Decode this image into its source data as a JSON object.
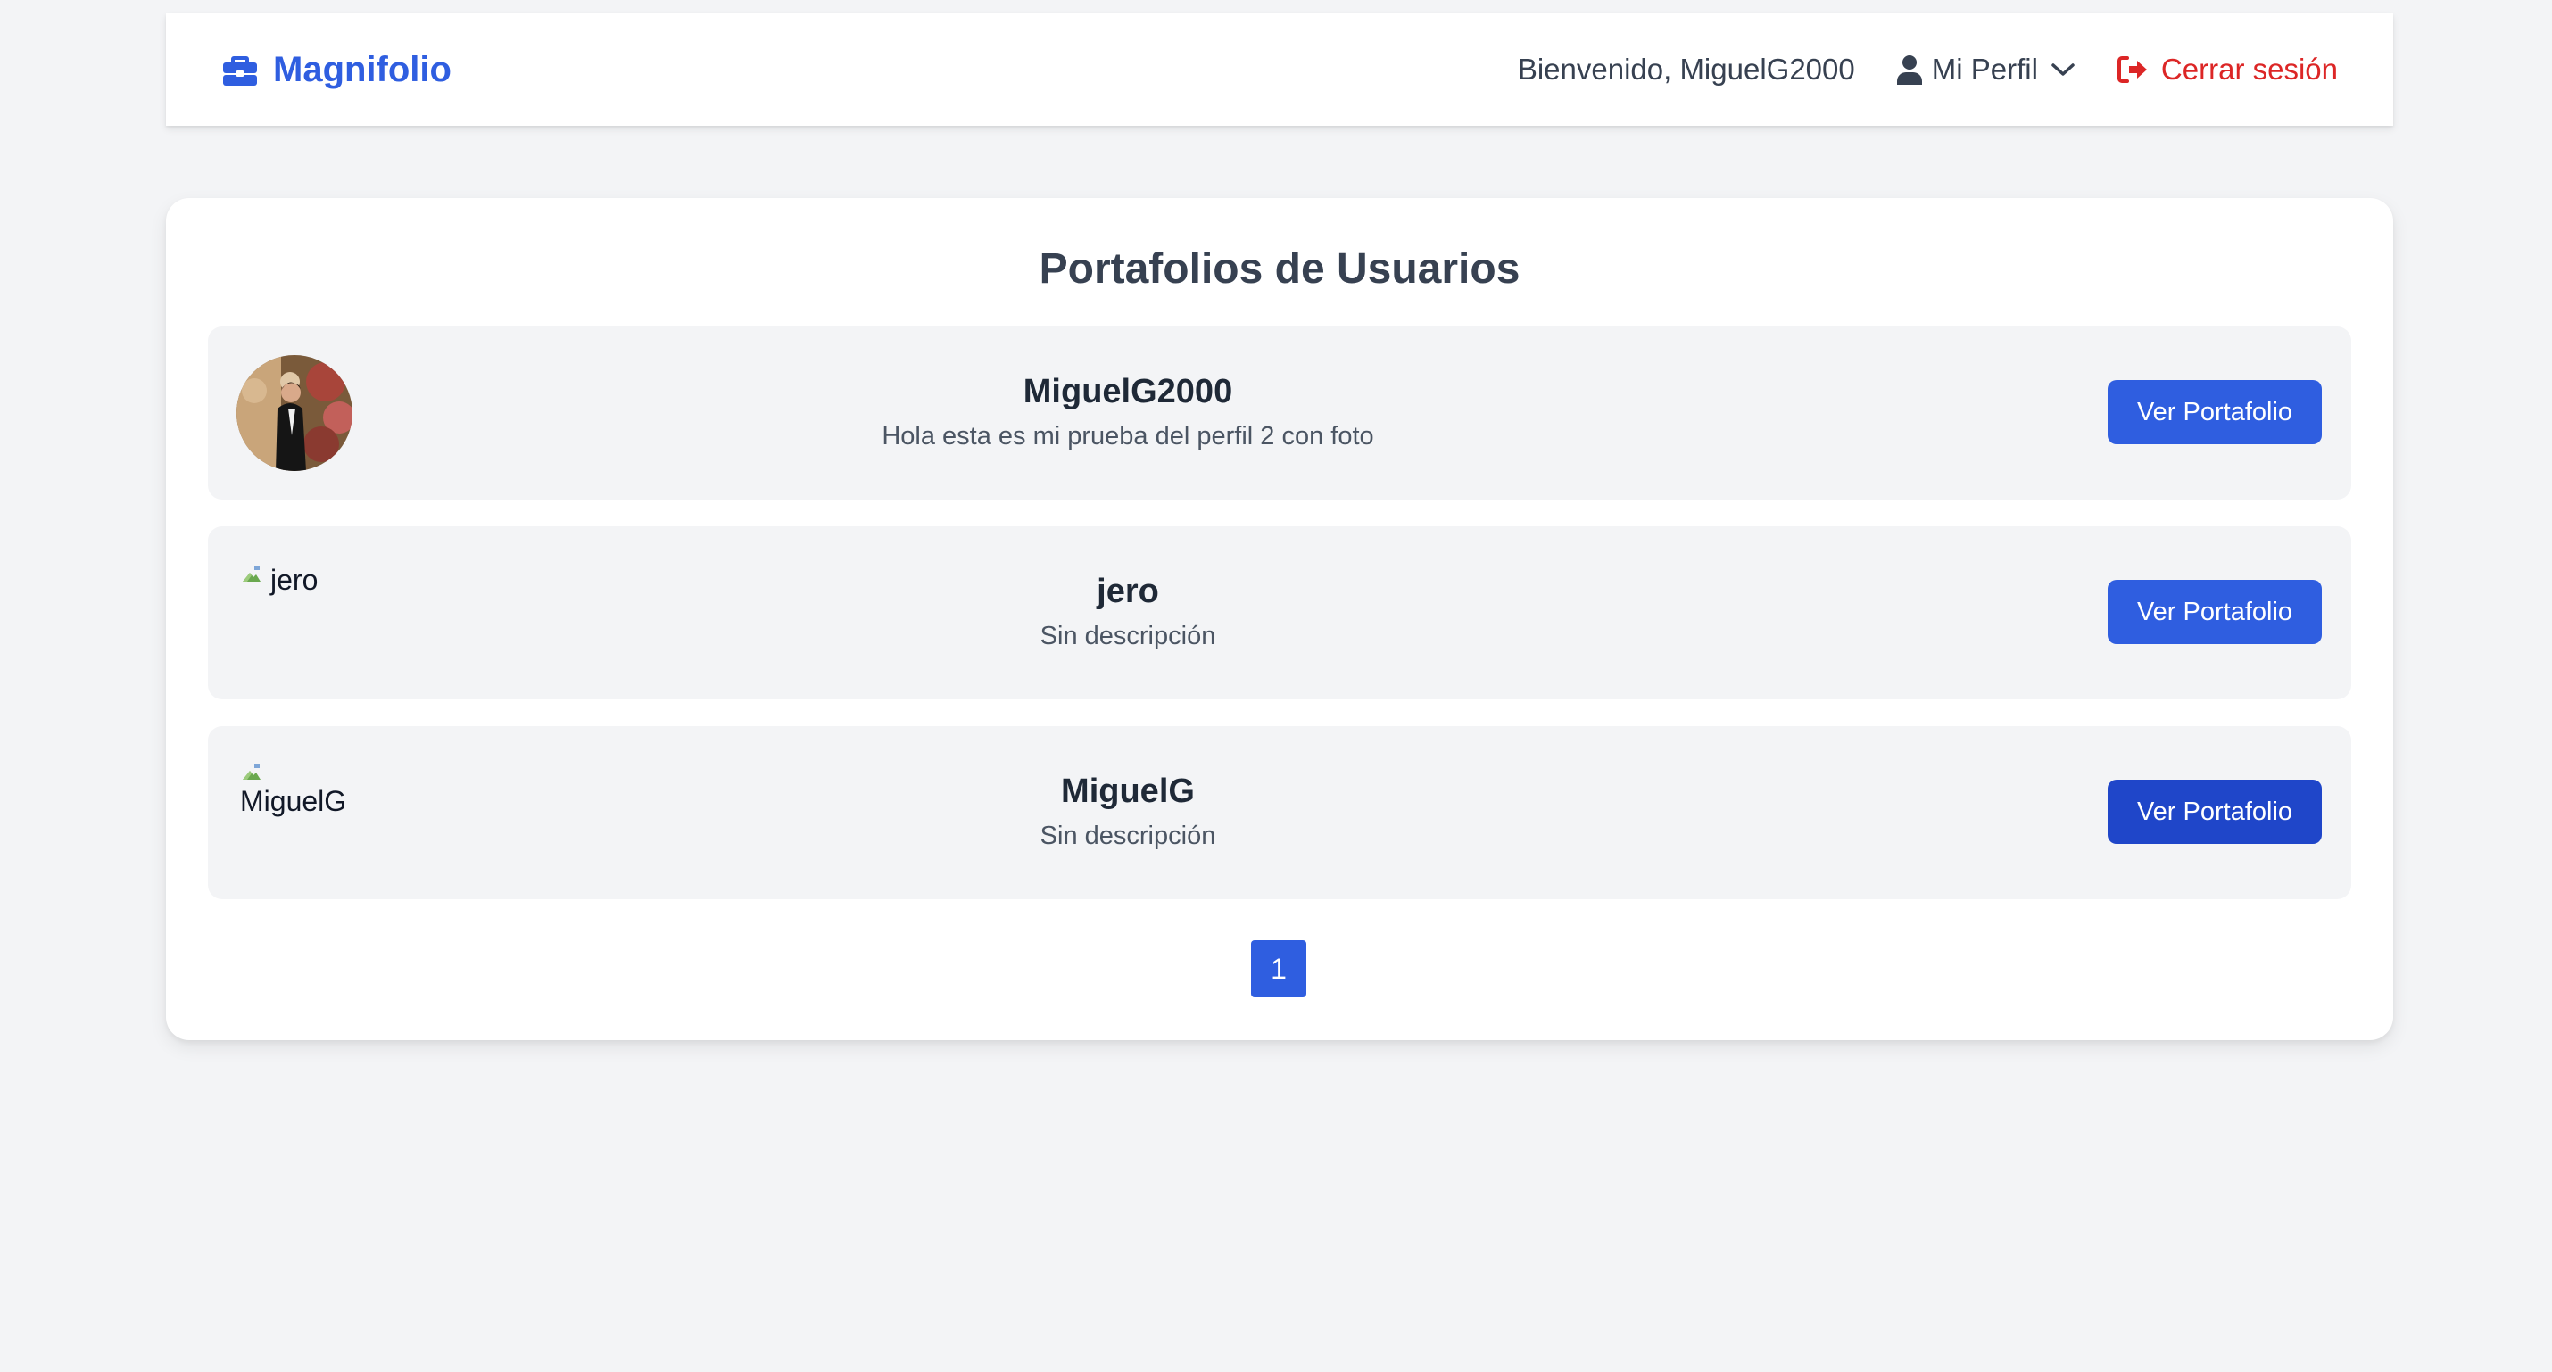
{
  "navbar": {
    "brand_name": "Magnifolio",
    "brand_icon": "briefcase-icon",
    "welcome_text": "Bienvenido, MiguelG2000",
    "profile_label": "Mi Perfil",
    "logout_label": "Cerrar sesión",
    "brand_color": "#2f5ee0",
    "logout_color": "#dc2626"
  },
  "main": {
    "title": "Portafolios de Usuarios",
    "users": [
      {
        "name": "MiguelG2000",
        "description": "Hola esta es mi prueba del perfil 2 con foto",
        "avatar_alt": "",
        "button_label": "Ver Portafolio"
      },
      {
        "name": "jero",
        "description": "Sin descripción",
        "avatar_alt": "jero",
        "button_label": "Ver Portafolio"
      },
      {
        "name": "MiguelG",
        "description": "Sin descripción",
        "avatar_alt": "MiguelG",
        "button_label": "Ver Portafolio"
      }
    ],
    "pagination": {
      "current_page": "1"
    }
  }
}
